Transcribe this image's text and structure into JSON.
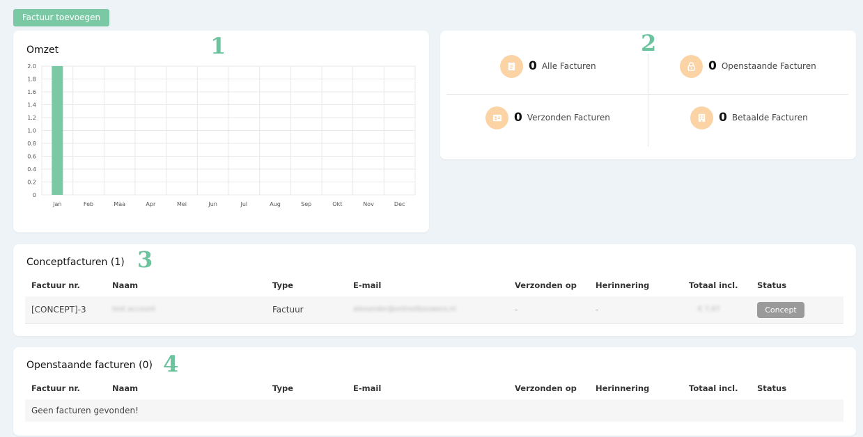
{
  "toolbar": {
    "add_invoice_label": "Factuur toevoegen"
  },
  "markers": {
    "m1": "1",
    "m2": "2",
    "m3": "3",
    "m4": "4"
  },
  "chart_section": {
    "title": "Omzet"
  },
  "chart_data": {
    "type": "bar",
    "title": "Omzet",
    "categories": [
      "Jan",
      "Feb",
      "Maa",
      "Apr",
      "Mei",
      "Jun",
      "Jul",
      "Aug",
      "Sep",
      "Okt",
      "Nov",
      "Dec"
    ],
    "values": [
      2,
      0,
      0,
      0,
      0,
      0,
      0,
      0,
      0,
      0,
      0,
      0
    ],
    "ylim": [
      0,
      2
    ],
    "yticks": [
      "0",
      "0.2",
      "0.4",
      "0.6",
      "0.8",
      "1.0",
      "1.2",
      "1.4",
      "1.6",
      "1.8",
      "2.0"
    ],
    "grid": true,
    "color": "#7bc8a4"
  },
  "stats": {
    "all": {
      "count": "0",
      "label": "Alle Facturen",
      "icon": "document-icon"
    },
    "open": {
      "count": "0",
      "label": "Openstaande Facturen",
      "icon": "lock-icon"
    },
    "sent": {
      "count": "0",
      "label": "Verzonden Facturen",
      "icon": "contact-card-icon"
    },
    "paid": {
      "count": "0",
      "label": "Betaalde Facturen",
      "icon": "building-icon"
    }
  },
  "columns": [
    "Factuur nr.",
    "Naam",
    "Type",
    "E-mail",
    "Verzonden op",
    "Herinnering",
    "Totaal incl.",
    "Status"
  ],
  "concept_section": {
    "title": "Conceptfacturen (1)",
    "rows": [
      {
        "number": "[CONCEPT]-3",
        "name": "test account",
        "type": "Factuur",
        "email": "alexander@ontnetbouwers.nl",
        "sent_on": "-",
        "reminder": "-",
        "total": "€ 7,97",
        "status": "Concept"
      }
    ]
  },
  "open_section": {
    "title": "Openstaande facturen (0)",
    "empty_text": "Geen facturen gevonden!"
  },
  "colors": {
    "accent": "#7bc8a4",
    "icon_bg": "#fcd3a4",
    "badge": "#9a9a9a",
    "background": "#edf3f6"
  }
}
